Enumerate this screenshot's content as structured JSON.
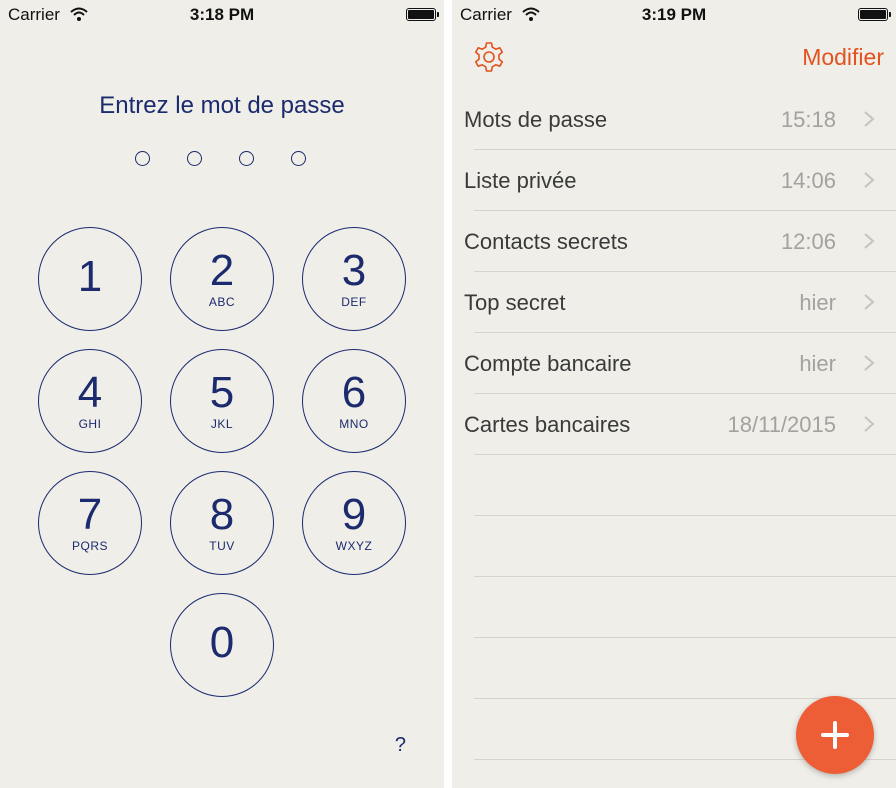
{
  "lock_screen": {
    "status": {
      "carrier": "Carrier",
      "time": "3:18 PM"
    },
    "prompt": "Entrez le mot de passe",
    "passcode_length": 4,
    "keys": [
      {
        "digit": "1",
        "letters": ""
      },
      {
        "digit": "2",
        "letters": "ABC"
      },
      {
        "digit": "3",
        "letters": "DEF"
      },
      {
        "digit": "4",
        "letters": "GHI"
      },
      {
        "digit": "5",
        "letters": "JKL"
      },
      {
        "digit": "6",
        "letters": "MNO"
      },
      {
        "digit": "7",
        "letters": "PQRS"
      },
      {
        "digit": "8",
        "letters": "TUV"
      },
      {
        "digit": "9",
        "letters": "WXYZ"
      },
      {
        "digit": "0",
        "letters": ""
      }
    ],
    "help": "?"
  },
  "list_screen": {
    "status": {
      "carrier": "Carrier",
      "time": "3:19 PM"
    },
    "nav": {
      "settings_icon": "gear-icon",
      "edit_label": "Modifier"
    },
    "items": [
      {
        "title": "Mots de passe",
        "date": "15:18"
      },
      {
        "title": "Liste privée",
        "date": "14:06"
      },
      {
        "title": "Contacts secrets",
        "date": "12:06"
      },
      {
        "title": "Top secret",
        "date": "hier"
      },
      {
        "title": "Compte bancaire",
        "date": "hier"
      },
      {
        "title": "Cartes bancaires",
        "date": "18/11/2015"
      }
    ],
    "add_icon": "plus-icon"
  },
  "colors": {
    "background": "#efeee8",
    "keypad_accent": "#1c2a6e",
    "accent": "#e2531f",
    "fab": "#ee5e36",
    "secondary_text": "#a3a29e"
  }
}
